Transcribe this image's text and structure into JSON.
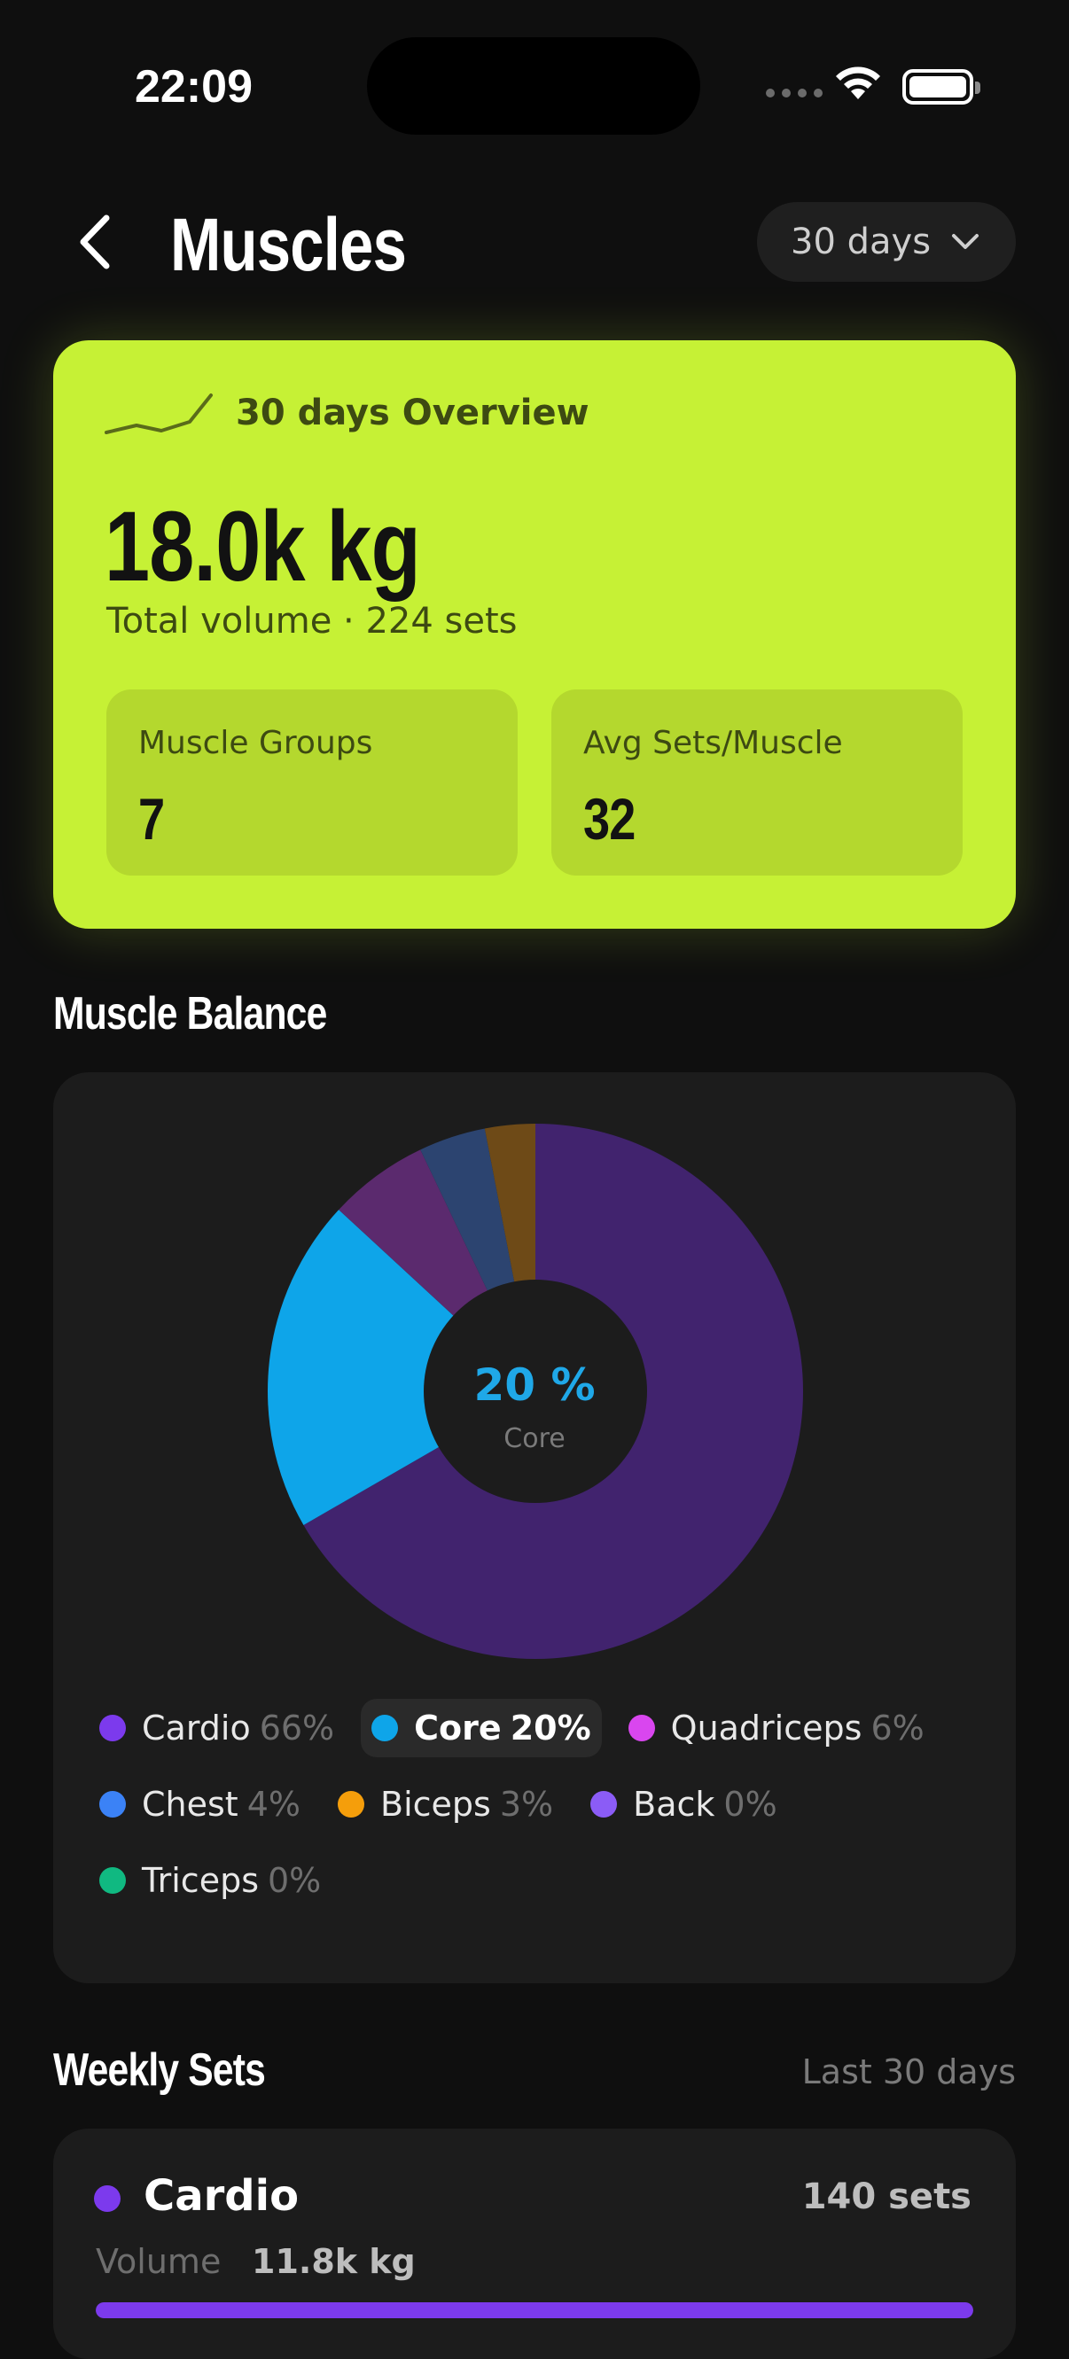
{
  "status_bar": {
    "time": "22:09"
  },
  "header": {
    "title": "Muscles",
    "range_label": "30 days"
  },
  "overview": {
    "heading": "30 days Overview",
    "total_volume": "18.0k kg",
    "subtitle": "Total volume · 224 sets",
    "stats": [
      {
        "label": "Muscle Groups",
        "value": "7"
      },
      {
        "label": "Avg Sets/Muscle",
        "value": "32"
      }
    ]
  },
  "balance": {
    "title": "Muscle Balance",
    "center_value": "20 %",
    "center_label": "Core",
    "legend": [
      {
        "name": "Cardio",
        "percent": "66%",
        "color": "#7c3aed",
        "active": false
      },
      {
        "name": "Core",
        "percent": "20%",
        "color": "#0ea5e9",
        "active": true
      },
      {
        "name": "Quadriceps",
        "percent": "6%",
        "color": "#d946ef",
        "active": false
      },
      {
        "name": "Chest",
        "percent": "4%",
        "color": "#3b82f6",
        "active": false
      },
      {
        "name": "Biceps",
        "percent": "3%",
        "color": "#f59e0b",
        "active": false
      },
      {
        "name": "Back",
        "percent": "0%",
        "color": "#8b5cf6",
        "active": false
      },
      {
        "name": "Triceps",
        "percent": "0%",
        "color": "#10b981",
        "active": false
      }
    ]
  },
  "chart_data": {
    "type": "pie",
    "categories": [
      "Cardio",
      "Core",
      "Quadriceps",
      "Chest",
      "Biceps",
      "Back",
      "Triceps"
    ],
    "values": [
      66,
      20,
      6,
      4,
      3,
      0,
      0
    ],
    "colors": [
      "#41236e",
      "#0ea5e9",
      "#5b2a6e",
      "#2c4470",
      "#6e4a17",
      "#8b5cf6",
      "#10b981"
    ],
    "highlighted": "Core"
  },
  "weekly_sets": {
    "title": "Weekly Sets",
    "range": "Last 30 days",
    "items": [
      {
        "name": "Cardio",
        "sets": "140 sets",
        "volume_label": "Volume",
        "volume": "11.8k kg",
        "progress": 1.0,
        "color": "#7c3aed"
      }
    ]
  }
}
